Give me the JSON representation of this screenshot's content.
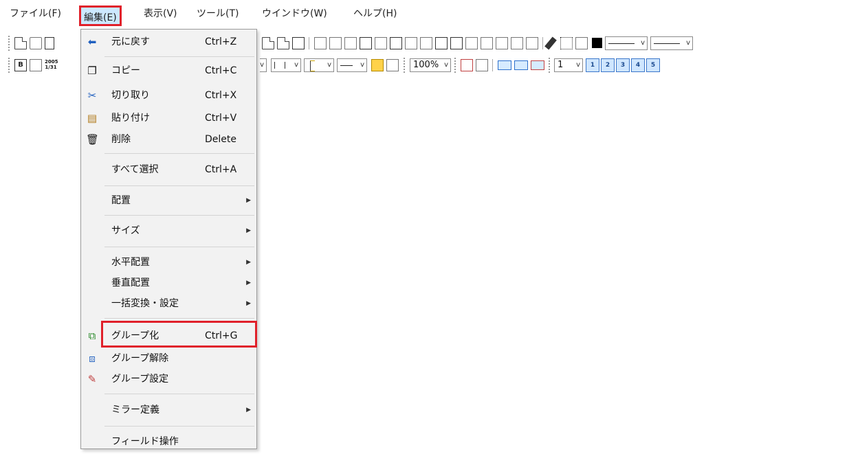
{
  "menubar": {
    "items": [
      "ファイル(F)",
      "編集(E)",
      "表示(V)",
      "ツール(T)",
      "ウインドウ(W)",
      "ヘルプ(H)"
    ]
  },
  "toolbar": {
    "zoom": "100%",
    "page": "1",
    "date_icon_top": "2005",
    "date_icon_bottom": "1/31",
    "b_icon": "B",
    "pages_buttons": [
      "1",
      "2",
      "3",
      "4",
      "5"
    ]
  },
  "edit_menu": {
    "items": [
      {
        "label": "元に戻す",
        "shortcut": "Ctrl+Z",
        "icon": "undo-icon"
      },
      {
        "label": "コピー",
        "shortcut": "Ctrl+C",
        "icon": "copy-icon"
      },
      {
        "label": "切り取り",
        "shortcut": "Ctrl+X",
        "icon": "cut-icon"
      },
      {
        "label": "貼り付け",
        "shortcut": "Ctrl+V",
        "icon": "paste-icon"
      },
      {
        "label": "削除",
        "shortcut": "Delete",
        "icon": "trash-icon"
      },
      {
        "label": "すべて選択",
        "shortcut": "Ctrl+A"
      },
      {
        "label": "配置",
        "submenu": "▶"
      },
      {
        "label": "サイズ",
        "submenu": "▶"
      },
      {
        "label": "水平配置",
        "submenu": "▶"
      },
      {
        "label": "垂直配置",
        "submenu": "▶"
      },
      {
        "label": "一括変換・設定",
        "submenu": "▶"
      },
      {
        "label": "グループ化",
        "shortcut": "Ctrl+G",
        "icon": "group-icon"
      },
      {
        "label": "グループ解除",
        "icon": "ungroup-icon"
      },
      {
        "label": "グループ設定",
        "icon": "group-settings-icon"
      },
      {
        "label": "ミラー定義",
        "submenu": "▶"
      },
      {
        "label": "フィールド操作"
      }
    ]
  },
  "colors": {
    "highlight_border": "#e0202a",
    "menu_selected_bg": "#cce8ff",
    "menu_bg": "#f2f2f2"
  }
}
